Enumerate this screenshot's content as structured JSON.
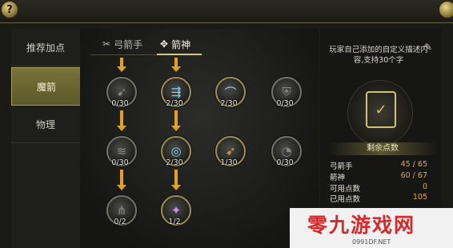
{
  "help_button": "?",
  "sidebar": {
    "items": [
      {
        "label": "推荐加点"
      },
      {
        "label": "魔箭"
      },
      {
        "label": "物理"
      }
    ]
  },
  "tabs": [
    {
      "label": "弓箭手",
      "icon": "crossed-bows-icon"
    },
    {
      "label": "箭神",
      "icon": "crossed-arrows-icon"
    }
  ],
  "skills": [
    {
      "icon": "bow-icon",
      "points": "0/30"
    },
    {
      "icon": "triple-arrow-icon",
      "points": "2/30"
    },
    {
      "icon": "arc-up-icon",
      "points": "2/30"
    },
    {
      "icon": "shield-icon",
      "points": "0/30"
    },
    {
      "icon": "multi-shot-icon",
      "points": "0/30"
    },
    {
      "icon": "vortex-arrow-icon",
      "points": "2/30"
    },
    {
      "icon": "golden-arrow-icon",
      "points": "1/30"
    },
    {
      "icon": "gauge-icon",
      "points": "0/30"
    },
    {
      "icon": "rain-arrow-icon",
      "points": "0/2"
    },
    {
      "icon": "magic-bow-icon",
      "points": "1/2"
    }
  ],
  "description": "玩家自己添加的自定义描述内容,支持30个字",
  "points_title": "剩余点数",
  "stats": [
    {
      "label": "弓箭手",
      "value": "45 / 65"
    },
    {
      "label": "箭神",
      "value": "60 / 67"
    },
    {
      "label": "可用点数",
      "value": "0"
    },
    {
      "label": "已用点数",
      "value": "105"
    }
  ],
  "watermark": {
    "big": "零九游戏网",
    "small": "0991DF.NET"
  }
}
